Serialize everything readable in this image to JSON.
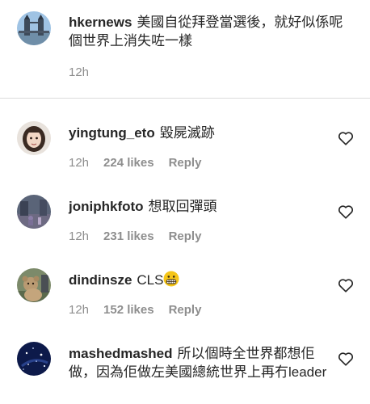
{
  "caption": {
    "username": "hkernews",
    "text": "美國自從拜登當選後，就好似係呢個世界上消失咗一樣",
    "time": "12h"
  },
  "comments": [
    {
      "username": "yingtung_eto",
      "text": "毀屍滅跡",
      "time": "12h",
      "likes": "224 likes",
      "reply": "Reply",
      "avatar": "girl-illustration-avatar"
    },
    {
      "username": "joniphkfoto",
      "text": "想取回彈頭",
      "time": "12h",
      "likes": "231 likes",
      "reply": "Reply",
      "avatar": "street-photo-avatar"
    },
    {
      "username": "dindinsze",
      "text": "CLS",
      "emoji": "grimacing-face-emoji",
      "time": "12h",
      "likes": "152 likes",
      "reply": "Reply",
      "avatar": "teddy-bear-avatar"
    },
    {
      "username": "mashedmashed",
      "text": "所以個時全世界都想佢做，因為佢做左美國總統世界上再冇leader",
      "avatar": "starry-sky-avatar"
    }
  ],
  "icons": {
    "like": "heart-outline-icon"
  },
  "colors": {
    "text": "#262626",
    "meta": "#8e8e8e",
    "divider": "#dbdbdb",
    "emoji": "#f5c518"
  }
}
